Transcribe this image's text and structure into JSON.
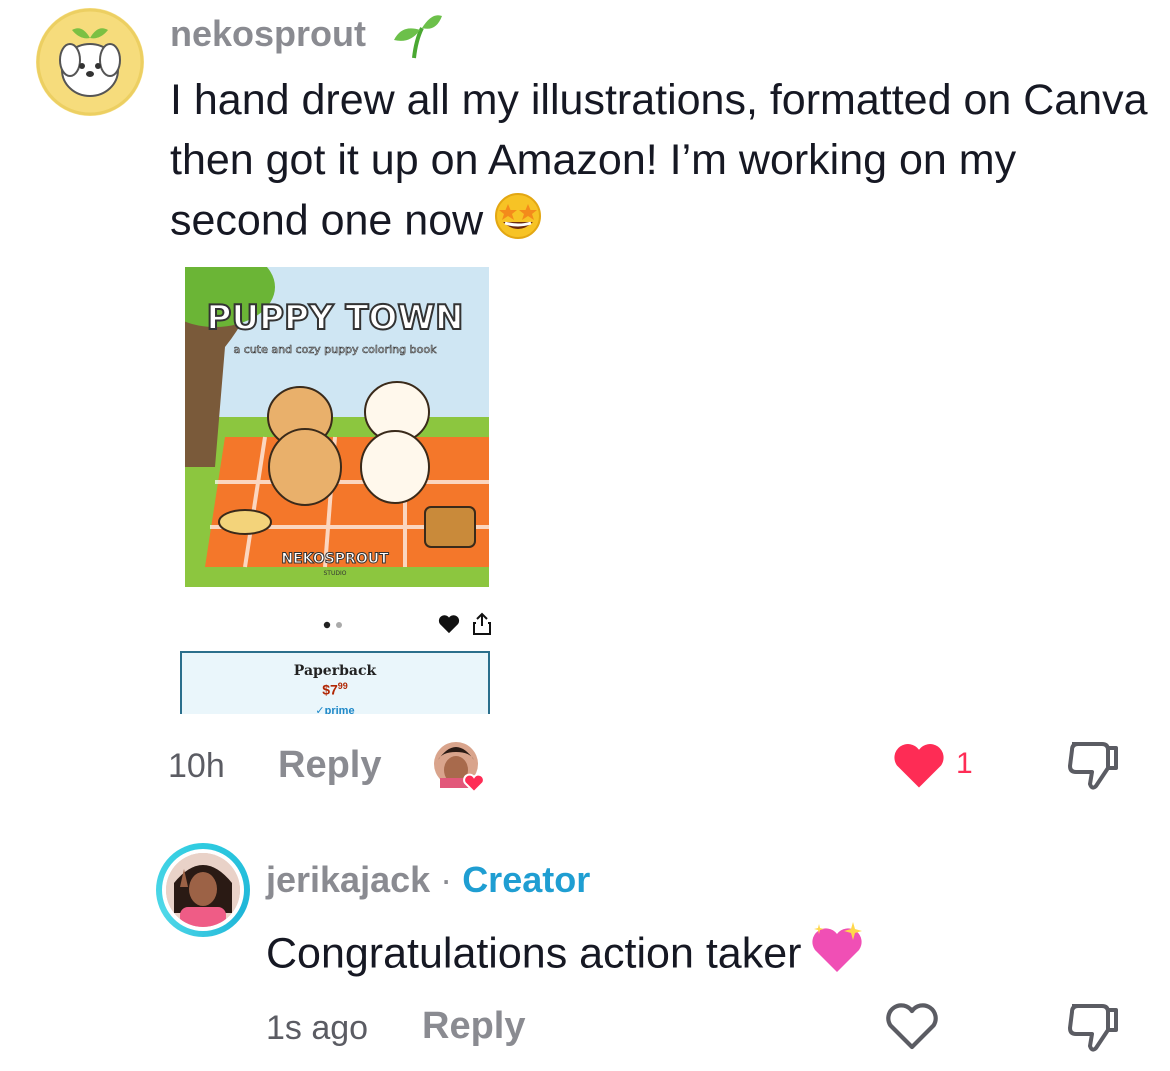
{
  "comment1": {
    "username": "nekosprout",
    "text": "I hand drew all my illustrations, formatted on Canva then got it up on Amazon! I’m working on my second one now",
    "emoji": "star-struck-emoji",
    "time": "10h",
    "reply_label": "Reply",
    "like_count": "1",
    "image": {
      "book_title": "PUPPY TOWN",
      "book_subtitle": "a cute and cozy puppy coloring book",
      "brand": "NEKOSPROUT",
      "brand_sub": "STUDIO",
      "format_label": "Paperback",
      "price": "$7",
      "price_cents": "99",
      "prime_label": "✓prime"
    }
  },
  "comment2": {
    "username": "jerikajack",
    "separator": "·",
    "badge": "Creator",
    "text": "Congratulations action taker",
    "emoji": "sparkling-heart-emoji",
    "time": "1s ago",
    "reply_label": "Reply"
  },
  "colors": {
    "like_red": "#fe2c55",
    "creator_blue": "#1f9ed2",
    "muted_gray": "#8a8b91"
  }
}
